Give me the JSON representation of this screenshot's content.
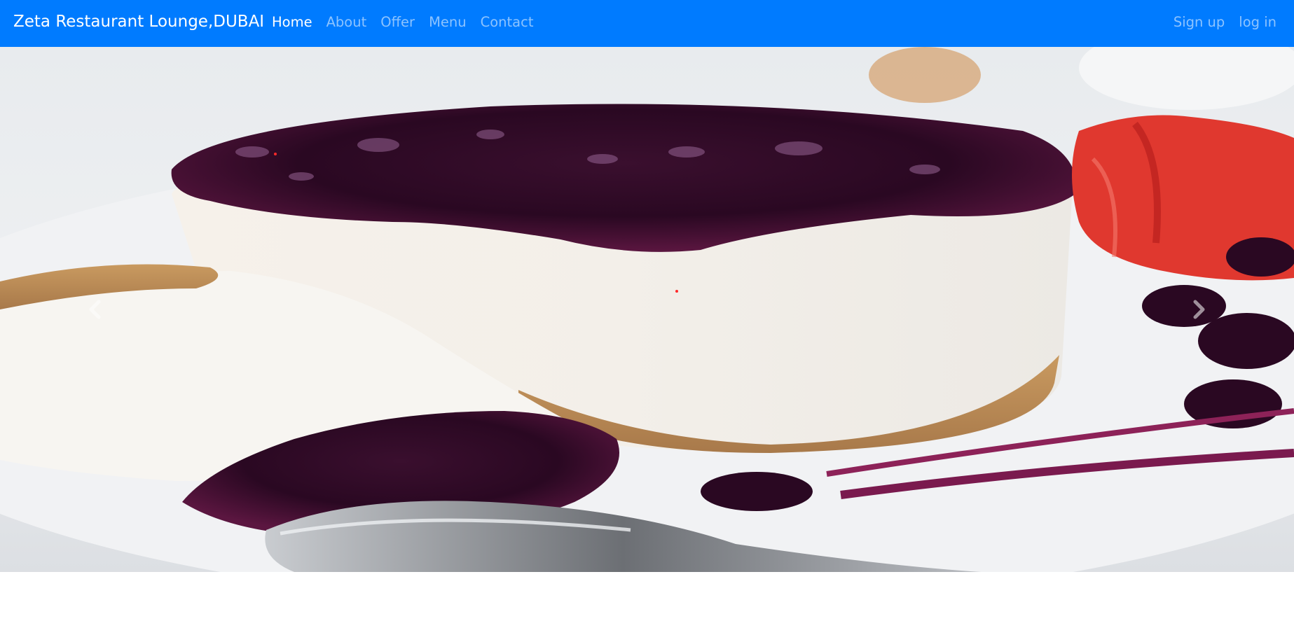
{
  "navbar": {
    "brand": "Zeta Restaurant Lounge,DUBAI",
    "links": [
      {
        "label": "Home",
        "active": true
      },
      {
        "label": "About",
        "active": false
      },
      {
        "label": "Offer",
        "active": false
      },
      {
        "label": "Menu",
        "active": false
      },
      {
        "label": "Contact",
        "active": false
      }
    ],
    "right_links": [
      {
        "label": "Sign up"
      },
      {
        "label": "log in"
      }
    ],
    "background_color": "#007bff"
  },
  "carousel": {
    "slide_image": "blueberry-cheesecake-photo",
    "prev_icon": "chevron-left-icon",
    "next_icon": "chevron-right-icon"
  }
}
